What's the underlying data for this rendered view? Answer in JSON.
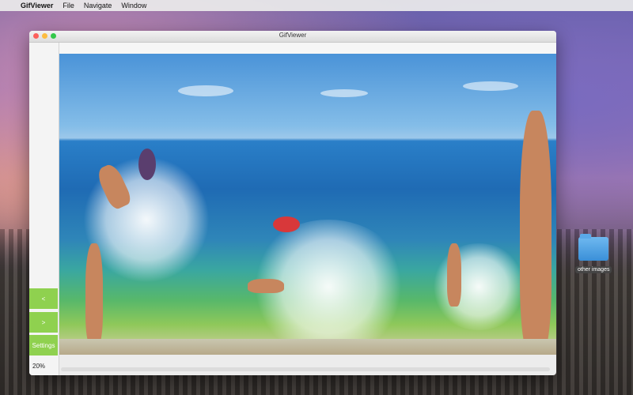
{
  "menubar": {
    "app_name": "GifViewer",
    "items": [
      "File",
      "Navigate",
      "Window"
    ]
  },
  "window": {
    "title": "GifViewer"
  },
  "sidebar": {
    "prev_label": "<",
    "next_label": ">",
    "settings_label": "Settings",
    "zoom": "20%"
  },
  "desktop": {
    "folder_label": "other images"
  },
  "colors": {
    "accent_green": "#8fd14f"
  },
  "icons": {
    "apple": "apple-icon",
    "folder": "folder-icon"
  }
}
